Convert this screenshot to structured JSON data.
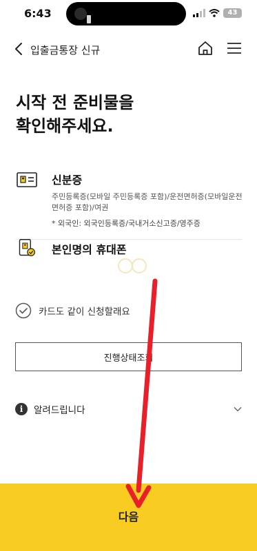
{
  "status_bar": {
    "time": "6:43",
    "battery": "43"
  },
  "header": {
    "title": "입출금통장 신규"
  },
  "main": {
    "title": "시작 전 준비물을\n확인해주세요.",
    "requirements": [
      {
        "title": "신분증",
        "description": "주민등록증(모바일 주민등록증 포함)/운전면허증(모바일운전면허증 포함)/여권",
        "note": "* 외국인: 외국인등록증/국내거소신고증/영주증"
      },
      {
        "title": "본인명의 휴대폰"
      }
    ],
    "card_option": {
      "label": "카드도 같이 신청할래요"
    },
    "status_button": {
      "label": "진행상태조회"
    },
    "notice": {
      "label": "알려드립니다"
    }
  },
  "footer": {
    "next_label": "다음"
  },
  "colors": {
    "accent": "#f9cc21",
    "arrow": "#e8202a"
  },
  "icons": [
    "back-arrow-icon",
    "home-icon",
    "hamburger-menu-icon",
    "id-card-icon",
    "phone-check-icon",
    "check-circle-icon",
    "info-icon",
    "chevron-down-icon"
  ]
}
